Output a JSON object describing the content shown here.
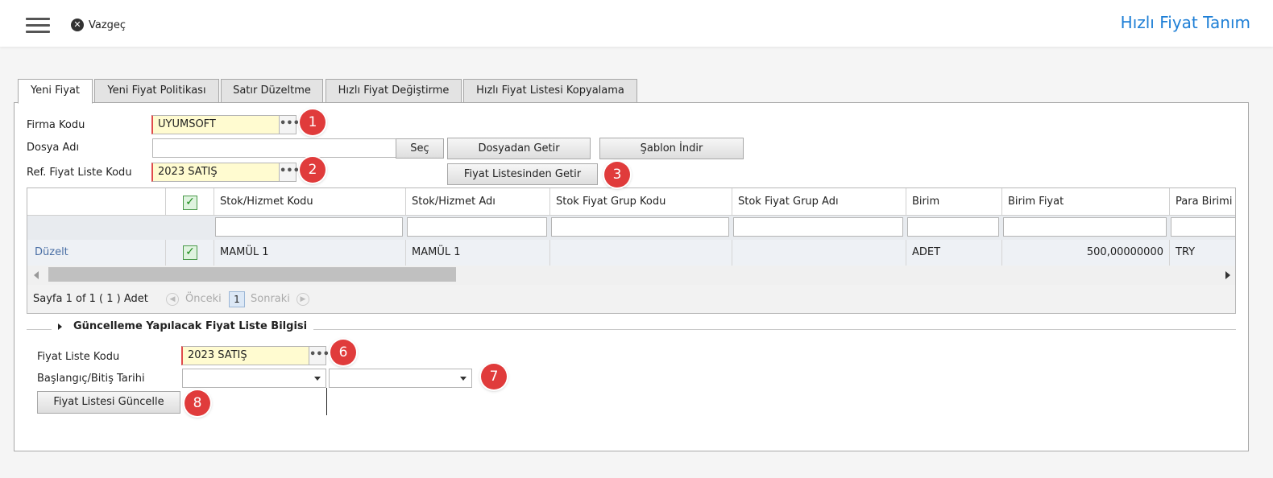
{
  "header": {
    "cancel_label": "Vazgeç",
    "title": "Hızlı Fiyat Tanım"
  },
  "tabs": [
    {
      "label": "Yeni Fiyat",
      "active": true
    },
    {
      "label": "Yeni Fiyat Politikası",
      "active": false
    },
    {
      "label": "Satır Düzeltme",
      "active": false
    },
    {
      "label": "Hızlı Fiyat Değiştirme",
      "active": false
    },
    {
      "label": "Hızlı Fiyat Listesi Kopyalama",
      "active": false
    }
  ],
  "form": {
    "firma_kodu_label": "Firma Kodu",
    "firma_kodu_value": "UYUMSOFT",
    "dosya_adi_label": "Dosya Adı",
    "dosya_adi_value": "",
    "sec_button": "Seç",
    "dosyadan_getir_button": "Dosyadan Getir",
    "sablon_indir_button": "Şablon İndir",
    "ref_fiyat_label": "Ref. Fiyat Liste Kodu",
    "ref_fiyat_value": "2023 SATIŞ",
    "fiyat_listesinden_getir_button": "Fiyat Listesinden Getir",
    "dots": "•••"
  },
  "badges": [
    "1",
    "2",
    "3",
    "6",
    "7",
    "8"
  ],
  "grid": {
    "columns": [
      "",
      "",
      "Stok/Hizmet Kodu",
      "Stok/Hizmet Adı",
      "Stok Fiyat Grup Kodu",
      "Stok Fiyat Grup Adı",
      "Birim",
      "Birim Fiyat",
      "Para Birimi"
    ],
    "rows": [
      {
        "action": "Düzelt",
        "checked": true,
        "stok_kodu": "MAMÜL 1",
        "stok_adi": "MAMÜL 1",
        "grup_kodu": "",
        "grup_adi": "",
        "birim": "ADET",
        "birim_fiyat": "500,00000000",
        "para_birimi": "TRY"
      }
    ],
    "pager": {
      "info": "Sayfa 1 of 1 ( 1 ) Adet",
      "prev": "Önceki",
      "page": "1",
      "next": "Sonraki"
    }
  },
  "update_section": {
    "title": "Güncelleme Yapılacak Fiyat Liste Bilgisi",
    "fiyat_liste_kodu_label": "Fiyat Liste Kodu",
    "fiyat_liste_kodu_value": "2023 SATIŞ",
    "tarih_label": "Başlangıç/Bitiş Tarihi",
    "baslangic_value": "",
    "bitis_value": "",
    "update_button": "Fiyat Listesi Güncelle"
  },
  "colors": {
    "accent": "#1e7fd6",
    "badge": "#e03b3b",
    "required_bg": "#fffbd0",
    "link": "#4a6fa5"
  }
}
